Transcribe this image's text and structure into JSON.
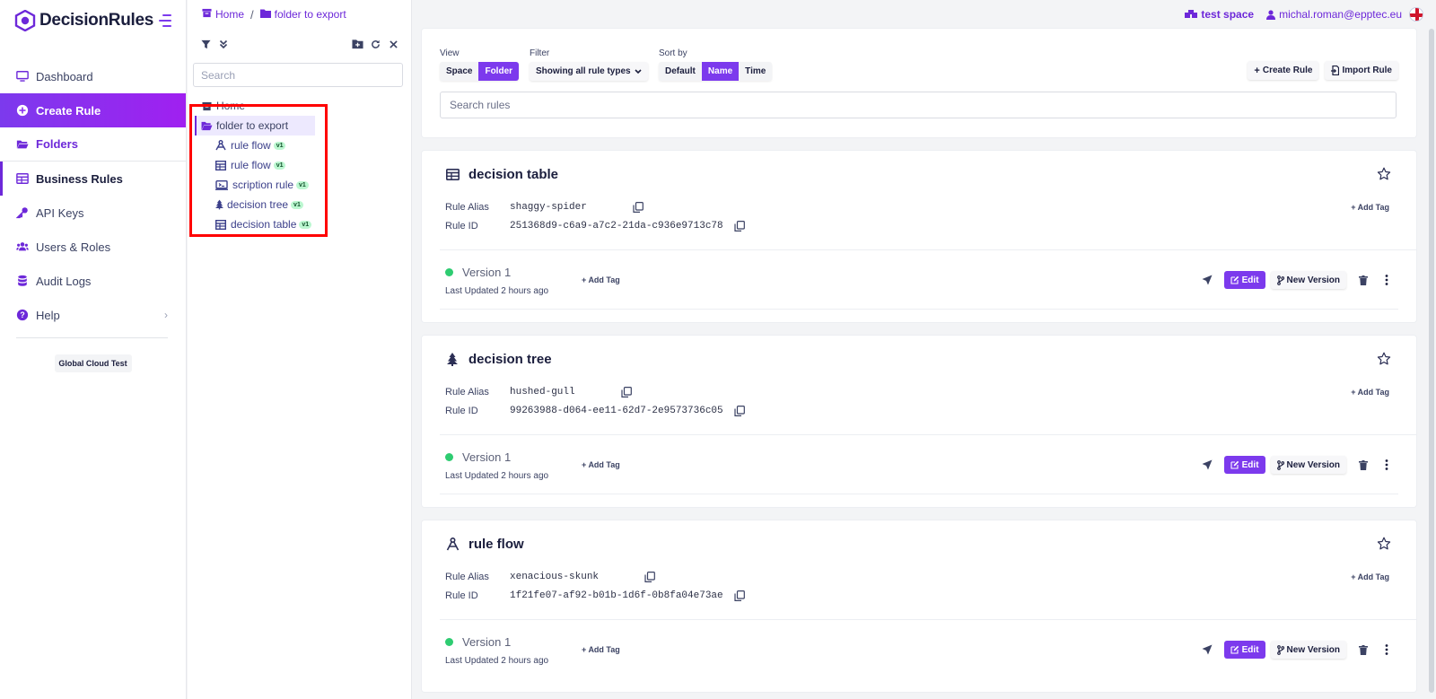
{
  "brand": {
    "name": "DecisionRules",
    "accent": "#7c3aed"
  },
  "sidebar": {
    "items": [
      {
        "label": "Dashboard",
        "icon": "monitor-icon"
      },
      {
        "label": "Create Rule",
        "icon": "plus-circle-icon"
      },
      {
        "label": "Folders",
        "icon": "folder-open-icon"
      },
      {
        "label": "Business Rules",
        "icon": "table-icon"
      },
      {
        "label": "API Keys",
        "icon": "key-icon"
      },
      {
        "label": "Users & Roles",
        "icon": "users-icon"
      },
      {
        "label": "Audit Logs",
        "icon": "database-icon"
      },
      {
        "label": "Help",
        "icon": "question-circle-icon"
      }
    ],
    "environment": "Global Cloud Test"
  },
  "breadcrumb": {
    "home": "Home",
    "folder": "folder to export"
  },
  "topbar": {
    "space": "test space",
    "user": "michal.roman@epptec.eu"
  },
  "folder_panel": {
    "search_placeholder": "Search",
    "home": "Home",
    "folder": "folder to export",
    "children": [
      {
        "label": "rule flow",
        "version": "v1",
        "icon": "rule-flow-icon"
      },
      {
        "label": "rule flow",
        "version": "v1",
        "icon": "table-icon"
      },
      {
        "label": "scription rule",
        "version": "v1",
        "icon": "script-icon"
      },
      {
        "label": "decision tree",
        "version": "v1",
        "icon": "tree-icon"
      },
      {
        "label": "decision table",
        "version": "v1",
        "icon": "table-icon"
      }
    ]
  },
  "controls": {
    "view_label": "View",
    "view_options": [
      "Space",
      "Folder"
    ],
    "view_active": "Folder",
    "filter_label": "Filter",
    "filter_value": "Showing all rule types",
    "sort_label": "Sort by",
    "sort_options": [
      "Default",
      "Name",
      "Time"
    ],
    "sort_active": "Name",
    "create_rule": "Create Rule",
    "import_rule": "Import Rule",
    "search_placeholder": "Search rules"
  },
  "labels": {
    "rule_alias": "Rule Alias",
    "rule_id": "Rule ID",
    "add_tag": "Add Tag",
    "edit": "Edit",
    "new_version": "New Version"
  },
  "rules": [
    {
      "title": "decision table",
      "icon": "table-icon",
      "alias": "shaggy-spider",
      "id": "251368d9-c6a9-a7c2-21da-c936e9713c78",
      "version": "Version 1",
      "updated": "Last Updated 2 hours ago"
    },
    {
      "title": "decision tree",
      "icon": "tree-icon",
      "alias": "hushed-gull",
      "id": "99263988-d064-ee11-62d7-2e9573736c05",
      "version": "Version 1",
      "updated": "Last Updated 2 hours ago"
    },
    {
      "title": "rule flow",
      "icon": "rule-flow-icon",
      "alias": "xenacious-skunk",
      "id": "1f21fe07-af92-b01b-1d6f-0b8fa04e73ae",
      "version": "Version 1",
      "updated": "Last Updated 2 hours ago"
    }
  ]
}
